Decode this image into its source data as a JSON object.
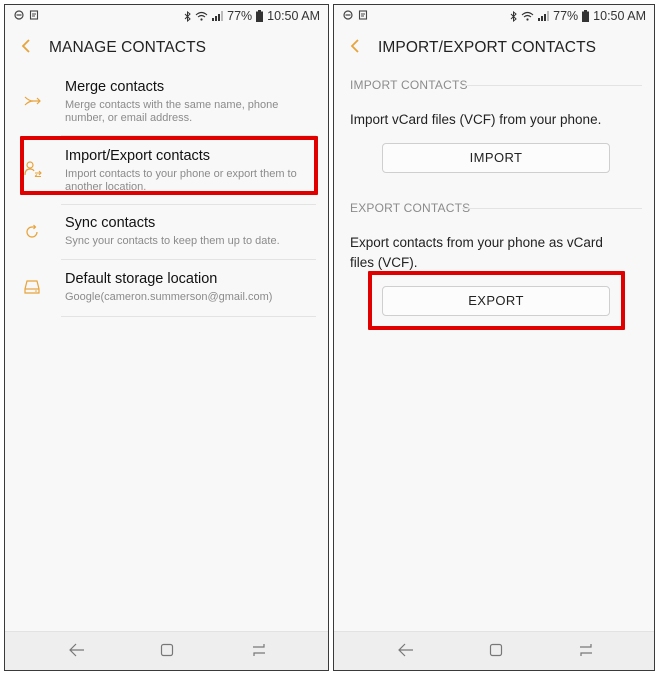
{
  "status": {
    "battery": "77%",
    "time": "10:50 AM"
  },
  "left": {
    "title": "MANAGE CONTACTS",
    "items": [
      {
        "title": "Merge contacts",
        "subtitle": "Merge contacts with the same name, phone number, or email address.",
        "icon": "merge-icon"
      },
      {
        "title": "Import/Export contacts",
        "subtitle": "Import contacts to your phone or export them to another location.",
        "icon": "import-export-icon"
      },
      {
        "title": "Sync contacts",
        "subtitle": "Sync your contacts to keep them up to date.",
        "icon": "sync-icon"
      },
      {
        "title": "Default storage location",
        "subtitle": "Google(cameron.summerson@gmail.com)",
        "icon": "storage-icon"
      }
    ]
  },
  "right": {
    "title": "IMPORT/EXPORT CONTACTS",
    "import": {
      "header": "IMPORT CONTACTS",
      "description": "Import vCard files (VCF) from your phone.",
      "button": "IMPORT"
    },
    "export": {
      "header": "EXPORT CONTACTS",
      "description": "Export contacts from your phone as vCard files (VCF).",
      "button": "EXPORT"
    }
  },
  "colors": {
    "accent": "#e8a33a",
    "highlight": "#e00000",
    "background": "#f8f8f8"
  }
}
